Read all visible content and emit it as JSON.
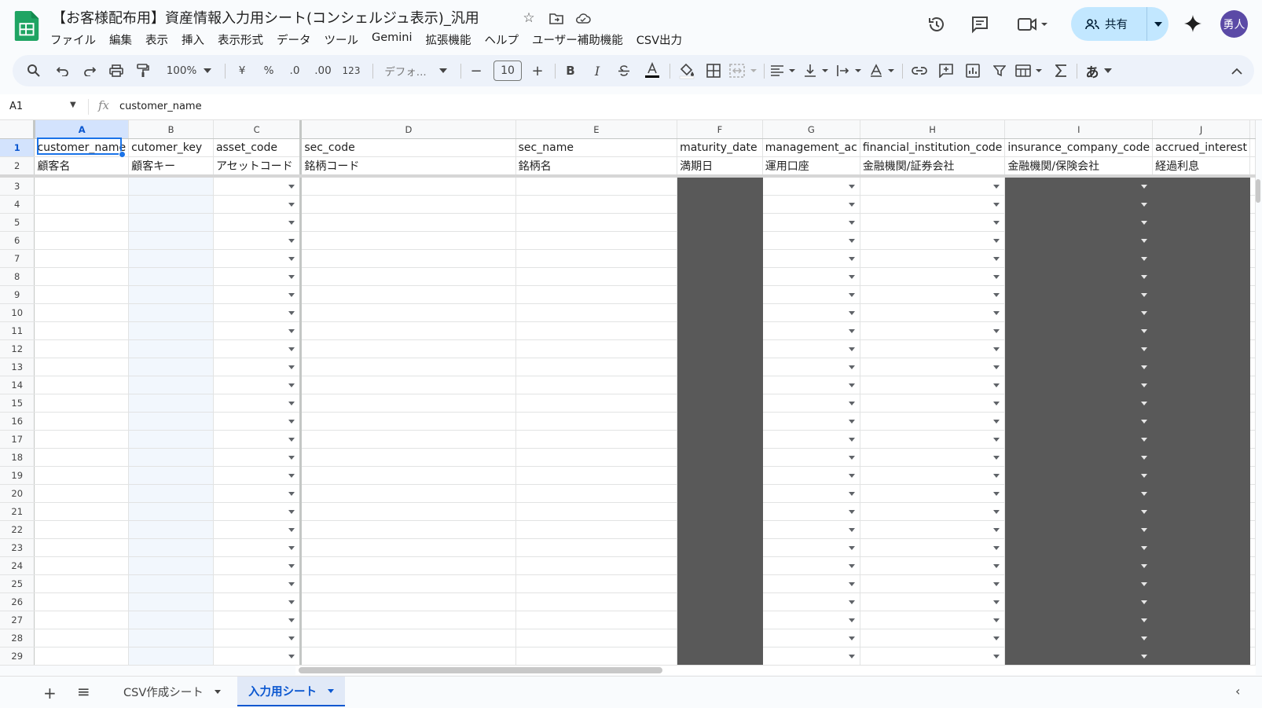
{
  "title": "【お客様配布用】資産情報入力用シート(コンシェルジュ表示)_汎用",
  "menu": [
    "ファイル",
    "編集",
    "表示",
    "挿入",
    "表示形式",
    "データ",
    "ツール",
    "Gemini",
    "拡張機能",
    "ヘルプ",
    "ユーザー補助機能",
    "CSV出力"
  ],
  "share": {
    "label": "共有"
  },
  "avatar": {
    "initials": "勇人",
    "color": "#5b4aa6"
  },
  "toolbar": {
    "zoom": "100%",
    "currency": "¥",
    "percent": "%",
    "dec_decrease": ".0",
    "dec_increase": ".00",
    "number_format": "123",
    "font": "デフォ...",
    "font_size": "10",
    "bold": "B",
    "italic": "I",
    "input_tools": "あ"
  },
  "formula_bar": {
    "cell_ref": "A1",
    "value": "customer_name"
  },
  "sheet": {
    "columns": [
      "A",
      "B",
      "C",
      "D",
      "E",
      "F",
      "G",
      "H",
      "I",
      "J"
    ],
    "selected_column": "A",
    "header_row_1": [
      "customer_name",
      "cutomer_key",
      "asset_code",
      "sec_code",
      "sec_name",
      "maturity_date",
      "management_ac",
      "financial_institution_code",
      "insurance_company_code",
      "accrued_interest"
    ],
    "header_row_2": [
      "顧客名",
      "顧客キー",
      "アセットコード",
      "銘柄コード",
      "銘柄名",
      "満期日",
      "運用口座",
      "金融機関/証券会社",
      "金融機関/保険会社",
      "経過利息"
    ],
    "row_numbers": [
      1,
      2,
      3,
      4,
      5,
      6,
      7,
      8,
      9,
      10,
      11,
      12,
      13,
      14,
      15,
      16,
      17,
      18,
      19,
      20,
      21,
      22,
      23,
      24,
      25,
      26,
      27,
      28,
      29
    ],
    "dropdown_columns": [
      "C",
      "G",
      "H",
      "I"
    ],
    "dark_columns": [
      "F",
      "I",
      "J"
    ],
    "dark_color": "#595959"
  },
  "tabs": [
    {
      "label": "CSV作成シート",
      "active": false
    },
    {
      "label": "入力用シート",
      "active": true
    }
  ],
  "colors": {
    "accent": "#0b57d0",
    "share_bg": "#c2e7ff"
  }
}
